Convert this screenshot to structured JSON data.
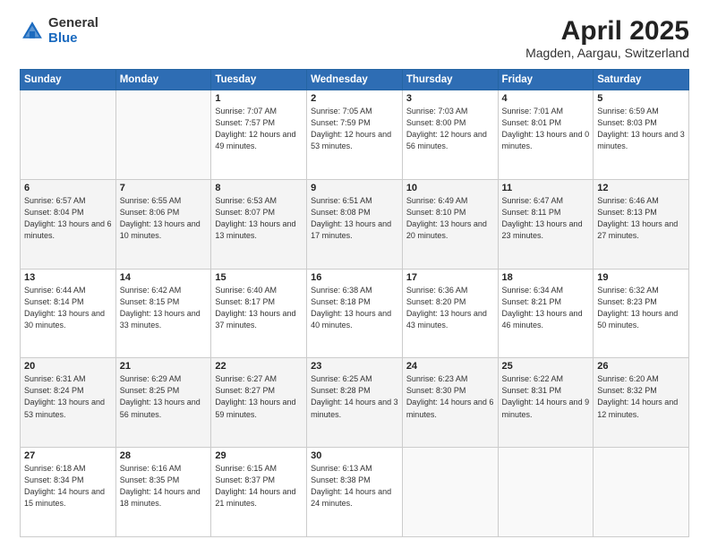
{
  "logo": {
    "general": "General",
    "blue": "Blue"
  },
  "header": {
    "month": "April 2025",
    "location": "Magden, Aargau, Switzerland"
  },
  "weekdays": [
    "Sunday",
    "Monday",
    "Tuesday",
    "Wednesday",
    "Thursday",
    "Friday",
    "Saturday"
  ],
  "weeks": [
    [
      {
        "day": "",
        "info": ""
      },
      {
        "day": "",
        "info": ""
      },
      {
        "day": "1",
        "info": "Sunrise: 7:07 AM\nSunset: 7:57 PM\nDaylight: 12 hours and 49 minutes."
      },
      {
        "day": "2",
        "info": "Sunrise: 7:05 AM\nSunset: 7:59 PM\nDaylight: 12 hours and 53 minutes."
      },
      {
        "day": "3",
        "info": "Sunrise: 7:03 AM\nSunset: 8:00 PM\nDaylight: 12 hours and 56 minutes."
      },
      {
        "day": "4",
        "info": "Sunrise: 7:01 AM\nSunset: 8:01 PM\nDaylight: 13 hours and 0 minutes."
      },
      {
        "day": "5",
        "info": "Sunrise: 6:59 AM\nSunset: 8:03 PM\nDaylight: 13 hours and 3 minutes."
      }
    ],
    [
      {
        "day": "6",
        "info": "Sunrise: 6:57 AM\nSunset: 8:04 PM\nDaylight: 13 hours and 6 minutes."
      },
      {
        "day": "7",
        "info": "Sunrise: 6:55 AM\nSunset: 8:06 PM\nDaylight: 13 hours and 10 minutes."
      },
      {
        "day": "8",
        "info": "Sunrise: 6:53 AM\nSunset: 8:07 PM\nDaylight: 13 hours and 13 minutes."
      },
      {
        "day": "9",
        "info": "Sunrise: 6:51 AM\nSunset: 8:08 PM\nDaylight: 13 hours and 17 minutes."
      },
      {
        "day": "10",
        "info": "Sunrise: 6:49 AM\nSunset: 8:10 PM\nDaylight: 13 hours and 20 minutes."
      },
      {
        "day": "11",
        "info": "Sunrise: 6:47 AM\nSunset: 8:11 PM\nDaylight: 13 hours and 23 minutes."
      },
      {
        "day": "12",
        "info": "Sunrise: 6:46 AM\nSunset: 8:13 PM\nDaylight: 13 hours and 27 minutes."
      }
    ],
    [
      {
        "day": "13",
        "info": "Sunrise: 6:44 AM\nSunset: 8:14 PM\nDaylight: 13 hours and 30 minutes."
      },
      {
        "day": "14",
        "info": "Sunrise: 6:42 AM\nSunset: 8:15 PM\nDaylight: 13 hours and 33 minutes."
      },
      {
        "day": "15",
        "info": "Sunrise: 6:40 AM\nSunset: 8:17 PM\nDaylight: 13 hours and 37 minutes."
      },
      {
        "day": "16",
        "info": "Sunrise: 6:38 AM\nSunset: 8:18 PM\nDaylight: 13 hours and 40 minutes."
      },
      {
        "day": "17",
        "info": "Sunrise: 6:36 AM\nSunset: 8:20 PM\nDaylight: 13 hours and 43 minutes."
      },
      {
        "day": "18",
        "info": "Sunrise: 6:34 AM\nSunset: 8:21 PM\nDaylight: 13 hours and 46 minutes."
      },
      {
        "day": "19",
        "info": "Sunrise: 6:32 AM\nSunset: 8:23 PM\nDaylight: 13 hours and 50 minutes."
      }
    ],
    [
      {
        "day": "20",
        "info": "Sunrise: 6:31 AM\nSunset: 8:24 PM\nDaylight: 13 hours and 53 minutes."
      },
      {
        "day": "21",
        "info": "Sunrise: 6:29 AM\nSunset: 8:25 PM\nDaylight: 13 hours and 56 minutes."
      },
      {
        "day": "22",
        "info": "Sunrise: 6:27 AM\nSunset: 8:27 PM\nDaylight: 13 hours and 59 minutes."
      },
      {
        "day": "23",
        "info": "Sunrise: 6:25 AM\nSunset: 8:28 PM\nDaylight: 14 hours and 3 minutes."
      },
      {
        "day": "24",
        "info": "Sunrise: 6:23 AM\nSunset: 8:30 PM\nDaylight: 14 hours and 6 minutes."
      },
      {
        "day": "25",
        "info": "Sunrise: 6:22 AM\nSunset: 8:31 PM\nDaylight: 14 hours and 9 minutes."
      },
      {
        "day": "26",
        "info": "Sunrise: 6:20 AM\nSunset: 8:32 PM\nDaylight: 14 hours and 12 minutes."
      }
    ],
    [
      {
        "day": "27",
        "info": "Sunrise: 6:18 AM\nSunset: 8:34 PM\nDaylight: 14 hours and 15 minutes."
      },
      {
        "day": "28",
        "info": "Sunrise: 6:16 AM\nSunset: 8:35 PM\nDaylight: 14 hours and 18 minutes."
      },
      {
        "day": "29",
        "info": "Sunrise: 6:15 AM\nSunset: 8:37 PM\nDaylight: 14 hours and 21 minutes."
      },
      {
        "day": "30",
        "info": "Sunrise: 6:13 AM\nSunset: 8:38 PM\nDaylight: 14 hours and 24 minutes."
      },
      {
        "day": "",
        "info": ""
      },
      {
        "day": "",
        "info": ""
      },
      {
        "day": "",
        "info": ""
      }
    ]
  ]
}
